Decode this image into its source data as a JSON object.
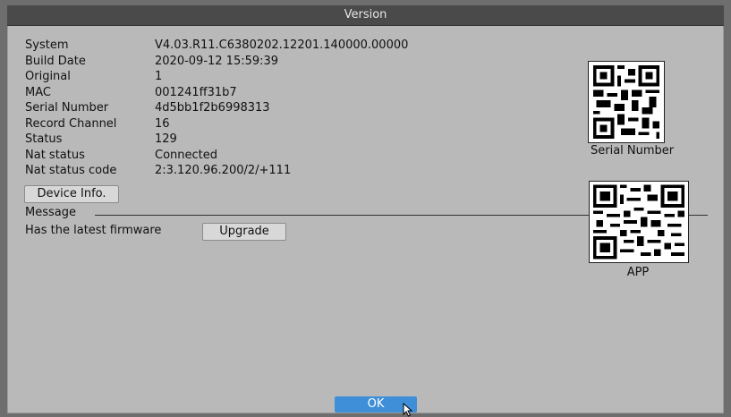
{
  "dialog": {
    "title": "Version"
  },
  "info": [
    {
      "label": "System",
      "value": "V4.03.R11.C6380202.12201.140000.00000"
    },
    {
      "label": "Build Date",
      "value": "2020-09-12 15:59:39"
    },
    {
      "label": "Original",
      "value": "1"
    },
    {
      "label": "MAC",
      "value": "001241ff31b7"
    },
    {
      "label": "Serial Number",
      "value": "4d5bb1f2b6998313"
    },
    {
      "label": "Record Channel",
      "value": "16"
    },
    {
      "label": "Status",
      "value": "129"
    },
    {
      "label": "Nat status",
      "value": "Connected"
    },
    {
      "label": "Nat status code",
      "value": "2:3.120.96.200/2/+111"
    }
  ],
  "buttons": {
    "device_info": "Device Info.",
    "upgrade": "Upgrade",
    "ok": "OK"
  },
  "message": {
    "label": "Message",
    "firmware_status": "Has the latest firmware"
  },
  "qr": {
    "serial_caption": "Serial Number",
    "app_caption": "APP"
  }
}
